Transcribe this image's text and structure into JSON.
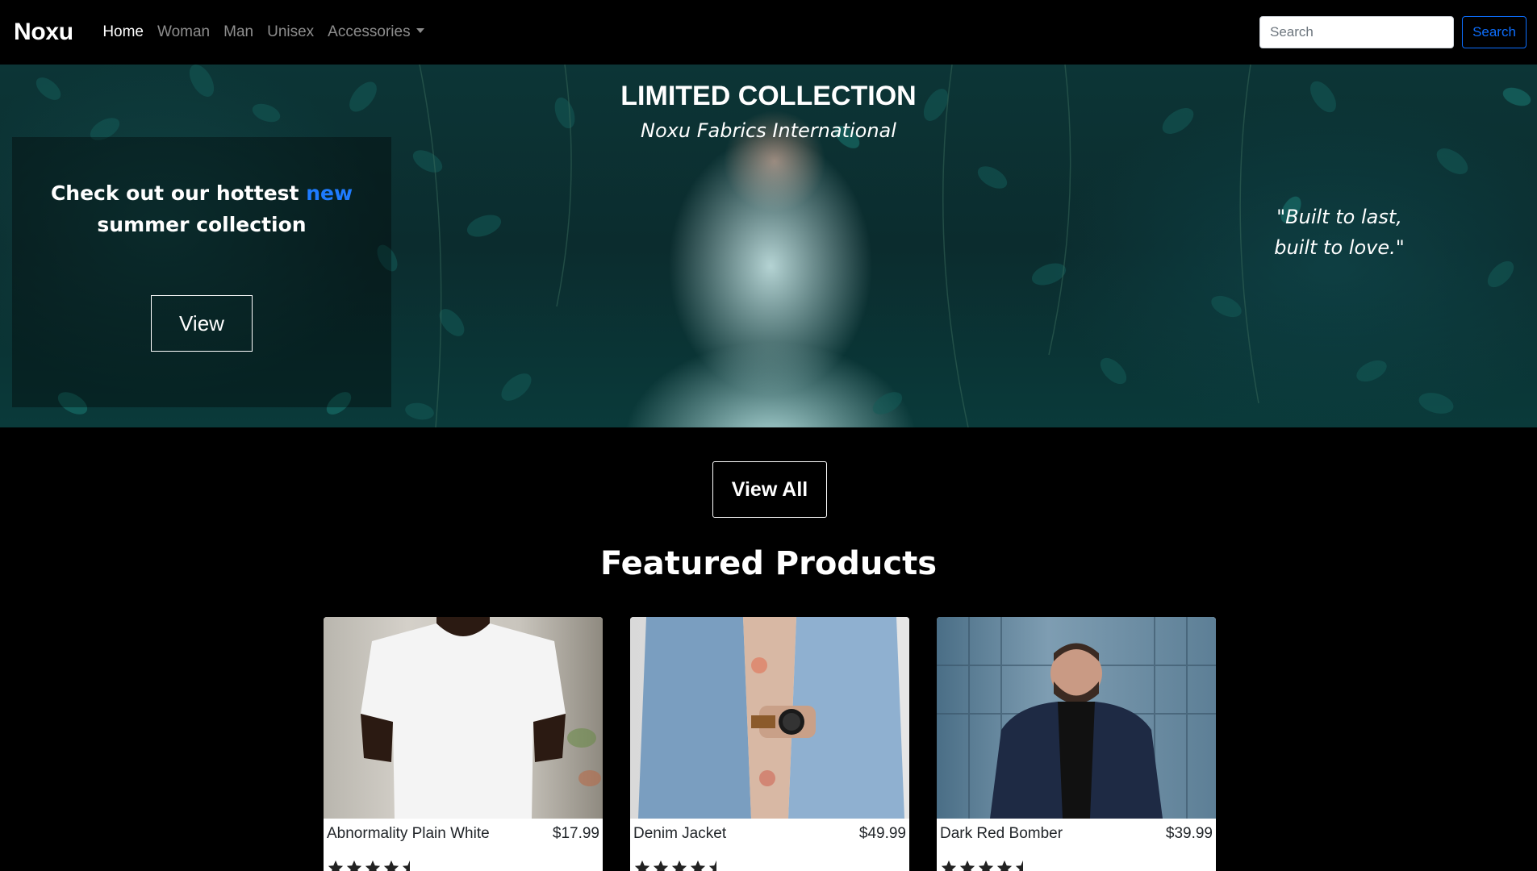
{
  "nav": {
    "brand": "Noxu",
    "links": [
      {
        "label": "Home",
        "active": true
      },
      {
        "label": "Woman",
        "active": false
      },
      {
        "label": "Man",
        "active": false
      },
      {
        "label": "Unisex",
        "active": false
      },
      {
        "label": "Accessories",
        "active": false,
        "dropdown": true
      }
    ],
    "search_placeholder": "Search",
    "search_button": "Search"
  },
  "hero": {
    "title": "LIMITED COLLECTION",
    "subtitle": "Noxu Fabrics International",
    "promo_before": "Check out our hottest ",
    "promo_highlight": "new",
    "promo_after": " summer collection",
    "promo_button": "View",
    "quote_line1": "\"Built to last,",
    "quote_line2": "built to love.\""
  },
  "view_all_label": "View All",
  "featured_title": "Featured Products",
  "products": [
    {
      "name": "Abnormality Plain White",
      "price": "$17.99",
      "rating": 4.5
    },
    {
      "name": "Denim Jacket",
      "price": "$49.99",
      "rating": 4.5
    },
    {
      "name": "Dark Red Bomber",
      "price": "$39.99",
      "rating": 4.5
    }
  ],
  "colors": {
    "accent": "#0d6efd",
    "highlight": "#1e7bff",
    "background": "#000000"
  }
}
